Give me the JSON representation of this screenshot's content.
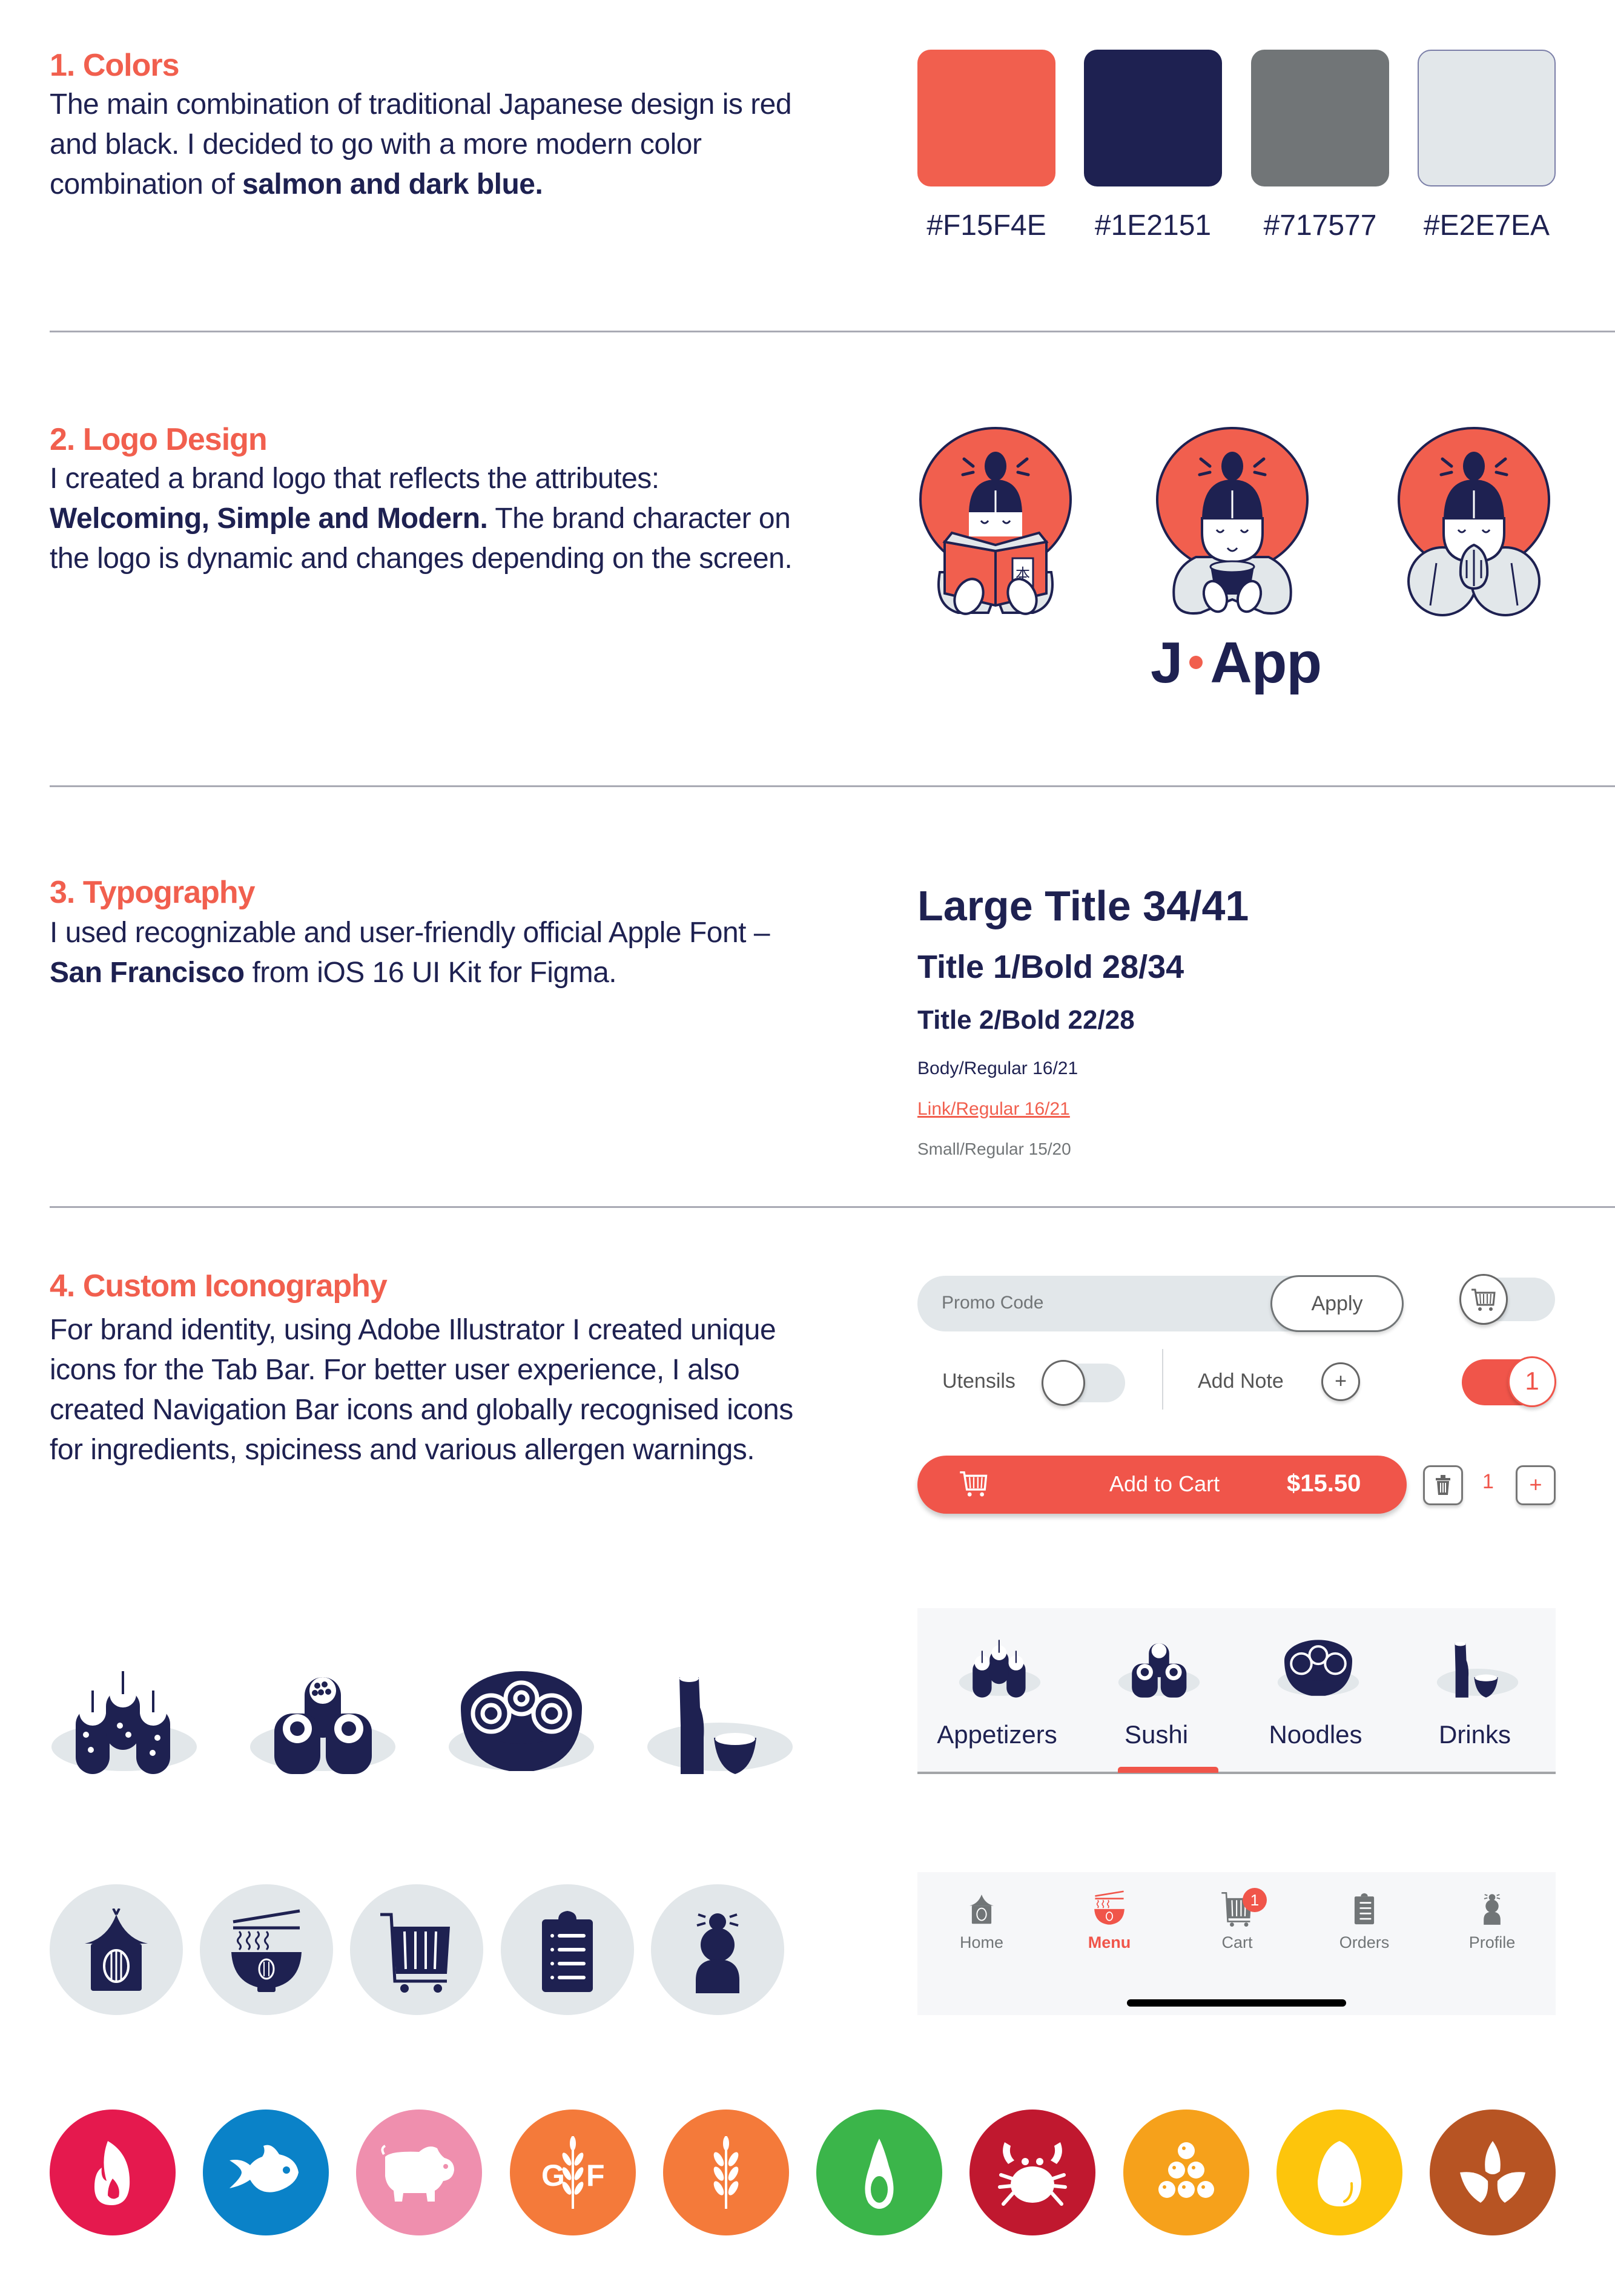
{
  "sections": {
    "colors": {
      "title": "1. Colors",
      "body_plain": "The main combination of traditional Japanese design is red and black. I decided to go with a more modern color combination of ",
      "body_bold": "salmon and dark blue.",
      "swatches": [
        {
          "label": "#F15F4E",
          "color": "#F15F4E"
        },
        {
          "label": "#1E2151",
          "color": "#1E2151"
        },
        {
          "label": "#717577",
          "color": "#717577"
        },
        {
          "label": "#E2E7EA",
          "color": "#E2E7EA"
        }
      ]
    },
    "logo": {
      "title": "2. Logo Design",
      "body_1": "I created a brand logo that reflects the attributes: ",
      "body_bold": "Welcoming, Simple and Modern.",
      "body_2": " The brand character on the logo is dynamic and changes depending on the screen.",
      "variants": [
        "reading-book",
        "holding-bowl",
        "praying-hands"
      ],
      "wordmark_left": "J",
      "wordmark_right": "App"
    },
    "typography": {
      "title": "3. Typography",
      "body_1": "I used recognizable and user-friendly official Apple Font – ",
      "body_bold": "San Francisco",
      "body_2": " from iOS 16 UI Kit for Figma.",
      "specimens": {
        "large_title": "Large Title 34/41",
        "title1": "Title 1/Bold 28/34",
        "title2": "Title 2/Bold 22/28",
        "body": "Body/Regular 16/21",
        "link": "Link/Regular 16/21",
        "small": "Small/Regular 15/20"
      }
    },
    "iconography": {
      "title": "4. Custom Iconography",
      "body": "For brand identity, using Adobe Illustrator I created unique icons for the Tab Bar.  For better user experience, I also created Navigation Bar icons and globally recognised icons for ingredients, spiciness and various allergen warnings."
    }
  },
  "controls": {
    "promo_placeholder": "Promo Code",
    "apply_label": "Apply",
    "utensils_label": "Utensils",
    "utensils_on": false,
    "add_note_label": "Add Note",
    "add_note_icon": "+",
    "cart_toggle_on": false,
    "count_toggle_value": "1",
    "add_to_cart_label": "Add to Cart",
    "add_to_cart_price": "$15.50",
    "quantity": "1",
    "plus_label": "+"
  },
  "tab_bar": {
    "tabs": [
      {
        "label": "Appetizers",
        "icon": "appetizers-icon",
        "active": false
      },
      {
        "label": "Sushi",
        "icon": "sushi-icon",
        "active": true
      },
      {
        "label": "Noodles",
        "icon": "noodles-icon",
        "active": false
      },
      {
        "label": "Drinks",
        "icon": "drinks-icon",
        "active": false
      }
    ]
  },
  "nav_bar": {
    "items": [
      {
        "label": "Home",
        "icon": "home-icon",
        "active": false
      },
      {
        "label": "Menu",
        "icon": "menu-bowl-icon",
        "active": true
      },
      {
        "label": "Cart",
        "icon": "cart-icon",
        "active": false,
        "badge": "1"
      },
      {
        "label": "Orders",
        "icon": "orders-icon",
        "active": false
      },
      {
        "label": "Profile",
        "icon": "profile-icon",
        "active": false
      }
    ]
  },
  "allergens": [
    {
      "name": "spicy",
      "color": "#E5194E"
    },
    {
      "name": "fish",
      "color": "#0A82C8"
    },
    {
      "name": "pork",
      "color": "#EF8FAE"
    },
    {
      "name": "gluten-free",
      "color": "#F47A3A"
    },
    {
      "name": "gluten",
      "color": "#F47A3A"
    },
    {
      "name": "avocado",
      "color": "#3BB54A"
    },
    {
      "name": "shellfish",
      "color": "#C0182F"
    },
    {
      "name": "roe",
      "color": "#F6A11B"
    },
    {
      "name": "egg",
      "color": "#FDC50C"
    },
    {
      "name": "vegan",
      "color": "#B75423"
    }
  ],
  "allergen_gf_letters": {
    "left": "G",
    "right": "F"
  }
}
